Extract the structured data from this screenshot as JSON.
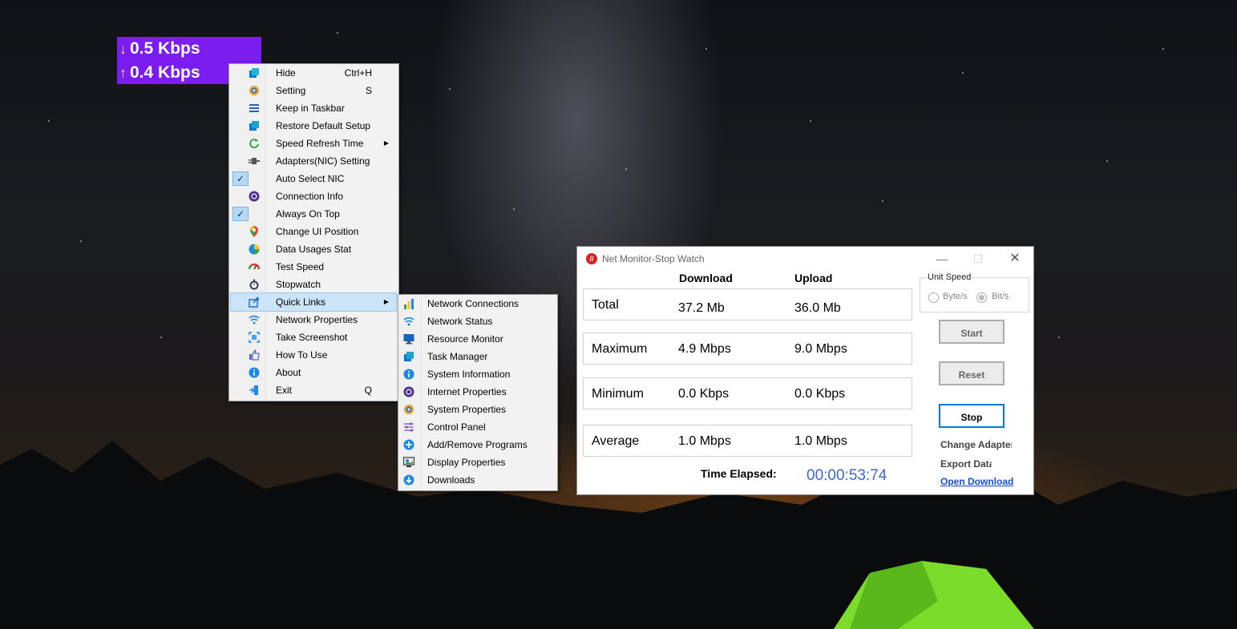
{
  "speed_widget": {
    "download_arrow": "↓",
    "download": "0.5 Kbps",
    "upload_arrow": "↑",
    "upload": "0.4 Kbps",
    "background_color": "#7b1cf0"
  },
  "context_menu": {
    "items": [
      {
        "label": "Hide",
        "shortcut": "Ctrl+H",
        "icon": "hide-icon"
      },
      {
        "label": "Setting",
        "shortcut": "S",
        "icon": "setting-gear-icon"
      },
      {
        "label": "Keep in Taskbar",
        "icon": "taskbar-icon"
      },
      {
        "label": "Restore Default Setup",
        "icon": "restore-icon"
      },
      {
        "label": "Speed Refresh Time",
        "submenu": true,
        "icon": "refresh-icon"
      },
      {
        "label": "Adapters(NIC) Setting",
        "icon": "adapter-icon"
      },
      {
        "label": "Auto Select NIC",
        "checked": true
      },
      {
        "label": "Connection Info",
        "icon": "connection-info-icon"
      },
      {
        "label": "Always On Top",
        "checked": true
      },
      {
        "label": "Change UI Position",
        "icon": "location-pin-icon"
      },
      {
        "label": "Data Usages Stat",
        "icon": "pie-chart-icon"
      },
      {
        "label": "Test Speed",
        "icon": "speedometer-icon"
      },
      {
        "label": "Stopwatch",
        "icon": "stopwatch-icon"
      },
      {
        "label": "Quick Links",
        "submenu": true,
        "highlighted": true,
        "icon": "share-icon"
      },
      {
        "label": "Network Properties",
        "icon": "wifi-icon"
      },
      {
        "label": "Take Screenshot",
        "icon": "screenshot-icon"
      },
      {
        "label": "How To Use",
        "icon": "thumbs-up-icon"
      },
      {
        "label": "About",
        "icon": "info-icon"
      },
      {
        "label": "Exit",
        "shortcut": "Q",
        "icon": "exit-icon"
      }
    ]
  },
  "quick_links_menu": {
    "items": [
      {
        "label": "Network Connections",
        "icon": "bar-chart-icon"
      },
      {
        "label": "Network Status",
        "icon": "wifi-icon"
      },
      {
        "label": "Resource Monitor",
        "icon": "monitor-icon"
      },
      {
        "label": "Task Manager",
        "icon": "task-manager-icon"
      },
      {
        "label": "System Information",
        "icon": "info-icon"
      },
      {
        "label": "Internet Properties",
        "icon": "globe-icon"
      },
      {
        "label": "System Properties",
        "icon": "gear-icon"
      },
      {
        "label": "Control Panel",
        "icon": "sliders-icon"
      },
      {
        "label": "Add/Remove Programs",
        "icon": "plus-icon"
      },
      {
        "label": "Display Properties",
        "icon": "display-icon"
      },
      {
        "label": "Downloads",
        "icon": "download-icon"
      }
    ]
  },
  "window": {
    "title": "Net Monitor-Stop Watch",
    "columns": {
      "download": "Download",
      "upload": "Upload"
    },
    "rows": [
      {
        "label": "Total",
        "download": "37.2 Mb",
        "upload": "36.0 Mb"
      },
      {
        "label": "Maximum",
        "download": "4.9 Mbps",
        "upload": "9.0 Mbps"
      },
      {
        "label": "Minimum",
        "download": "0.0 Kbps",
        "upload": "0.0 Kbps"
      },
      {
        "label": "Average",
        "download": "1.0 Mbps",
        "upload": "1.0 Mbps"
      }
    ],
    "time_elapsed_label": "Time Elapsed:",
    "time_elapsed_value": "00:00:53:74",
    "unit_speed": {
      "title": "Unit Speed",
      "options": [
        "Byte/s",
        "Bit/s"
      ],
      "selected": "Bit/s"
    },
    "buttons": {
      "start": "Start",
      "reset": "Reset",
      "stop": "Stop"
    },
    "links": {
      "change_adapter": "Change Adapter",
      "export_data": "Export Data",
      "open_download": "Open Download"
    },
    "accent_color": "#3a69d0"
  }
}
